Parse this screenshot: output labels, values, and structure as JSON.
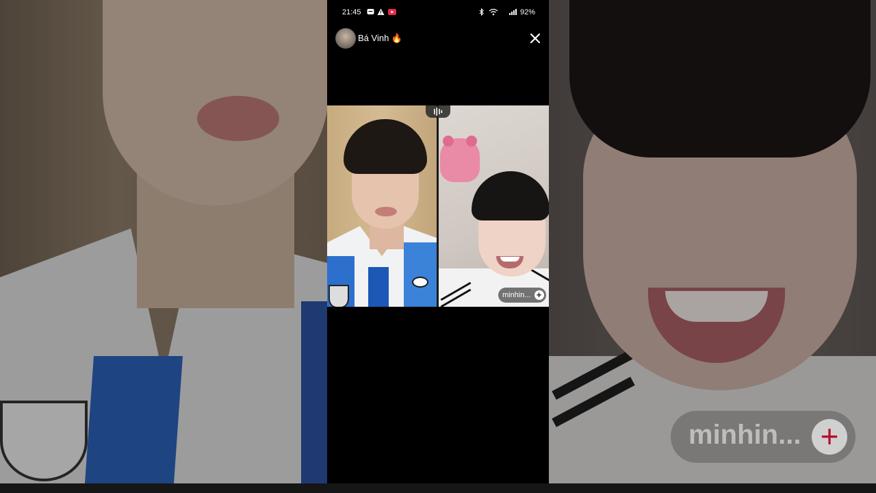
{
  "status_bar": {
    "time": "21:45",
    "battery": "92%"
  },
  "live": {
    "host_name": "Bá Vinh 🔥",
    "guest_name": "minhin...",
    "follow_symbol": "+"
  },
  "background_overlay": {
    "guest_name": "minhin...",
    "follow_symbol": "+"
  },
  "icons": [
    "messenger-icon",
    "warning-icon",
    "youtube-icon",
    "bluetooth-icon",
    "wifi-icon",
    "signal-icon",
    "battery-icon",
    "close-icon",
    "microphone-icon",
    "plus-icon"
  ],
  "colors": {
    "background": "#000000",
    "follow_plus_accent": "#b3122e"
  }
}
